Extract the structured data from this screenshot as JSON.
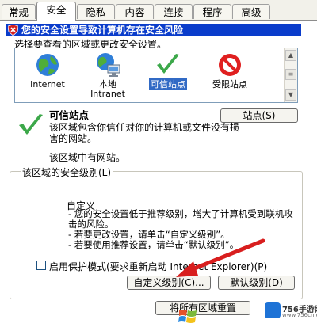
{
  "tabs": [
    "常规",
    "安全",
    "隐私",
    "内容",
    "连接",
    "程序",
    "高级"
  ],
  "banner": "您的安全设置导致计算机存在安全风险",
  "instruction": "选择要查看的区域或更改安全设置。",
  "zones": [
    {
      "label": "Internet",
      "icon": "globe-icon"
    },
    {
      "label": "本地\nIntranet",
      "icon": "intranet-icon"
    },
    {
      "label": "可信站点",
      "icon": "checkmark-icon",
      "selected": true
    },
    {
      "label": "受限站点",
      "icon": "no-entry-icon"
    }
  ],
  "zone_detail": {
    "title": "可信站点",
    "description": "该区域包含你信任对你的计算机或文件没有损害的网站。",
    "no_sites": "该区域中有网站。",
    "sites_button": "站点(S)"
  },
  "security_level": {
    "group_label": "该区域的安全级别(L)",
    "level_name": "自定义",
    "lines": [
      "- 您的安全设置低于推荐级别，增大了计算机受到联机攻击的风险。",
      "- 若要更改设置，请单击“自定义级别”。",
      "- 若要使用推荐设置，请单击“默认级别”。"
    ],
    "protected_mode": "启用保护模式(要求重新启动 Internet Explorer)(P)",
    "protected_mode_checked": false,
    "custom_button": "自定义级别(C)...",
    "default_button": "默认级别(D)",
    "reset_button": "将所有区域重置"
  },
  "watermark": {
    "title": "756手游网",
    "sub": "www.756cn.com"
  },
  "colors": {
    "banner": "#0a3ccb",
    "selection": "#316ac5",
    "arrow": "#d81e1e"
  }
}
